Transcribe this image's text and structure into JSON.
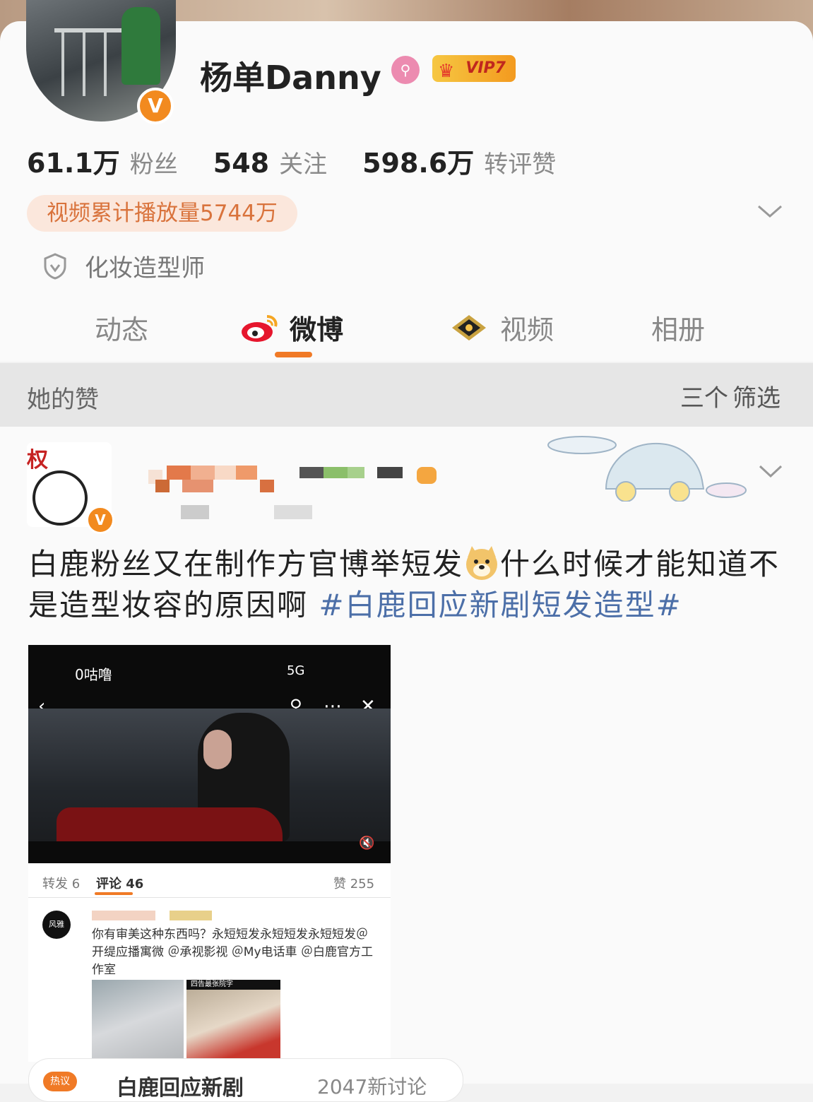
{
  "profile": {
    "name": "杨单Danny",
    "vip_label": "VIP7",
    "verify_mark": "V",
    "stats": [
      {
        "value": "61.1万",
        "label": "粉丝"
      },
      {
        "value": "548",
        "label": "关注"
      },
      {
        "value": "598.6万",
        "label": "转评赞"
      }
    ],
    "video_plays": "视频累计播放量5744万",
    "certification": "化妆造型师"
  },
  "tabs": [
    {
      "label": "动态",
      "active": false
    },
    {
      "label": "微博",
      "active": true
    },
    {
      "label": "视频",
      "active": false
    },
    {
      "label": "相册",
      "active": false
    }
  ],
  "section": {
    "title": "她的赞",
    "filter_icon": "三个",
    "filter_label": "筛选"
  },
  "post": {
    "avatar_text": "权",
    "text_part1": "白鹿粉丝又在制作方官博举短发",
    "text_part2": "什么时候才能知道不是造型妆容的原因啊",
    "hashtag": "#白鹿回应新剧短发造型#"
  },
  "screenshot": {
    "status_app": "0咕噜",
    "signal": "5G",
    "repost": "转发 6",
    "comment": "评论 46",
    "like": "赞 255",
    "comment_avatar": "风雅",
    "comment_text": "你有审美这种东西吗？永短短发永短短发永短短发＠开缇应播寓微 ＠承视影视 ＠My电话車 ＠白鹿官方工作室",
    "thumb_caption": "四告最张院字"
  },
  "topic": {
    "badge": "热议",
    "name": "白鹿回应新剧",
    "count": "2047新讨论"
  },
  "colors": {
    "accent": "#f07a26",
    "link": "#4c6fa8",
    "vip": "#f6c742"
  }
}
